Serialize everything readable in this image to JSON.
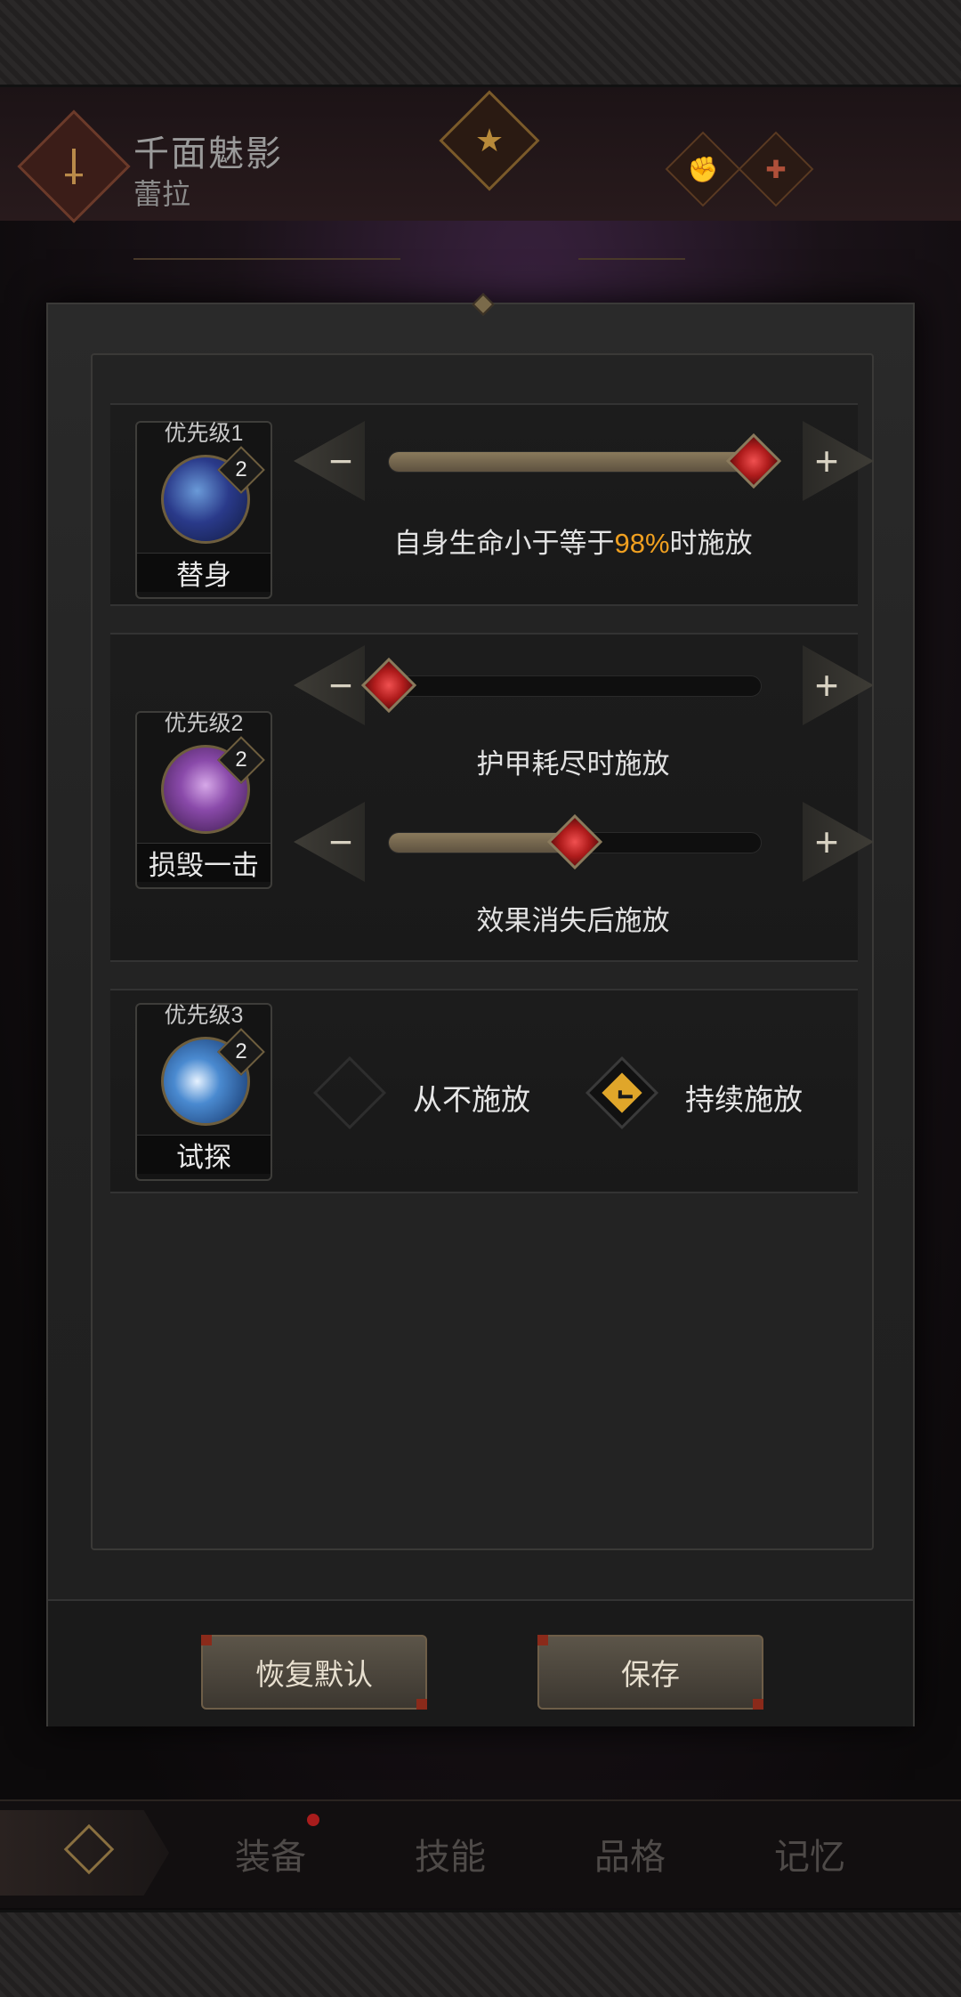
{
  "header": {
    "title": "千面魅影",
    "character_name": "蕾拉"
  },
  "modal": {
    "skills": [
      {
        "priority_label": "优先级1",
        "name": "替身",
        "level": "2",
        "sliders": [
          {
            "value_percent": 98,
            "text_before": "自身生命小于等于",
            "highlight": "98%",
            "text_after": "时施放"
          }
        ]
      },
      {
        "priority_label": "优先级2",
        "name": "损毁一击",
        "level": "2",
        "sliders": [
          {
            "value_percent": 0,
            "text": "护甲耗尽时施放"
          },
          {
            "value_percent": 50,
            "text": "效果消失后施放"
          }
        ]
      },
      {
        "priority_label": "优先级3",
        "name": "试探",
        "level": "2",
        "options": [
          {
            "label": "从不施放",
            "checked": false
          },
          {
            "label": "持续施放",
            "checked": true
          }
        ]
      }
    ],
    "buttons": {
      "reset": "恢复默认",
      "save": "保存"
    }
  },
  "bottom_nav": {
    "tabs": [
      "装备",
      "技能",
      "品格",
      "记忆"
    ]
  },
  "colors": {
    "highlight": "#f0a020",
    "checkbox_on": "#e0a62a",
    "knob": "#d02a2a"
  }
}
